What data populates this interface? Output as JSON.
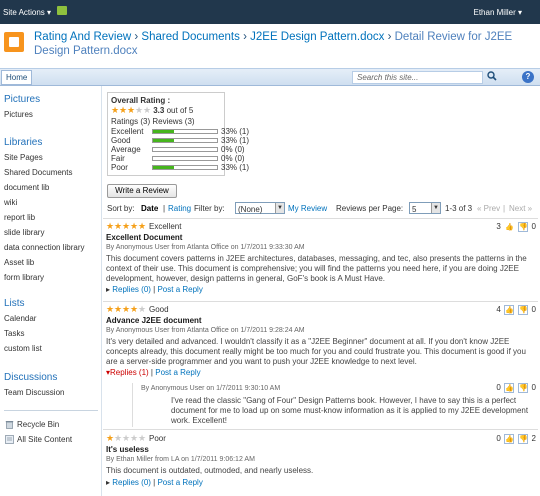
{
  "topbar": {
    "site_actions": "Site Actions",
    "site_actions_arrow": "▾",
    "user": "Ethan Miller",
    "user_arrow": "▾"
  },
  "breadcrumb": {
    "part1": "Rating And Review",
    "part2": "Shared Documents",
    "part3": "J2EE Design Pattern.docx",
    "current": "Detail Review for J2EE Design Pattern.docx",
    "sep": "›"
  },
  "nav": {
    "home": "Home",
    "search_placeholder": "Search this site...",
    "search_icon": "magnifier-icon",
    "help_label": "?"
  },
  "leftnav": {
    "pictures_header": "Pictures",
    "pictures_items": [
      "Pictures"
    ],
    "libraries_header": "Libraries",
    "libraries_items": [
      "Site Pages",
      "Shared Documents",
      "document lib",
      "wiki",
      "report lib",
      "slide library",
      "data connection library",
      "Asset lib",
      "form library"
    ],
    "lists_header": "Lists",
    "lists_items": [
      "Calendar",
      "Tasks",
      "custom list"
    ],
    "discussions_header": "Discussions",
    "discussions_items": [
      "Team Discussion"
    ],
    "recycle_bin": "Recycle Bin",
    "all_site_content": "All Site Content"
  },
  "overall": {
    "title": "Overall Rating :",
    "score": "3.3",
    "out_of": "out of 5",
    "stars": 3.3,
    "counts": "Ratings (3) Reviews (3)",
    "breakdown": [
      {
        "label": "Excellent",
        "fraction": 0.33,
        "text": "33% (1)"
      },
      {
        "label": "Good",
        "fraction": 0.33,
        "text": "33% (1)"
      },
      {
        "label": "Average",
        "fraction": 0.0,
        "text": "0% (0)"
      },
      {
        "label": "Fair",
        "fraction": 0.0,
        "text": "0% (0)"
      },
      {
        "label": "Poor",
        "fraction": 0.33,
        "text": "33% (1)"
      }
    ]
  },
  "write_review": "Write a Review",
  "sortbar": {
    "sort_by": "Sort by:",
    "date": "Date",
    "sep": "|",
    "rating": "Rating",
    "filter_by": "Filter by:",
    "filter_value": "(None)",
    "my_review": "My Review",
    "per_page": "Reviews per Page:",
    "per_page_value": "5",
    "range": "1-3 of 3",
    "prev": "« Prev",
    "next": "Next »"
  },
  "reviews": [
    {
      "stars": 5,
      "rating_label": "Excellent",
      "up": "3",
      "down": "0",
      "title": "Excellent Document",
      "byline": "By Anonymous User from Atlanta Office on 1/7/2011 9:33:30 AM",
      "body": "This document covers patterns in J2EE architectures, databases, messaging, and tec, also presents the patterns in the context of their use. This document is comprehensive; you will find the patterns you need here, if you are doing J2EE development, however, design patterns in general, GoF's book is A Must Have.",
      "replies": "Replies (0)",
      "post": "Post a Reply"
    },
    {
      "stars": 4,
      "rating_label": "Good",
      "up": "4",
      "down": "0",
      "title": "Advance J2EE document",
      "byline": "By Anonymous User from Atlanta Office on 1/7/2011 9:28:24 AM",
      "body": "It's very detailed and advanced. I wouldn't classify it as a \"J2EE Beginner\" document at all. If you don't know J2EE concepts already, this document really might be too much for you and could frustrate you. This document is good if you are a server-side programmer and you want to push your J2EE knowledge to next level.",
      "replies": "Replies (1)",
      "post": "Post a Reply",
      "reply": {
        "byline": "By Anonymous User on 1/7/2011 9:30:10 AM",
        "up": "0",
        "down": "0",
        "body": "I've read the classic \"Gang of Four\" Design Patterns book. However, I have to say this is a perfect document for me to load up on some must-know information as it is applied to my J2EE development work. Excellent!"
      }
    },
    {
      "stars": 1,
      "rating_label": "Poor",
      "up": "0",
      "down": "2",
      "title": "It's useless",
      "byline": "By Ethan Miller from LA on 1/7/2011 9:06:12 AM",
      "body": "This document is outdated, outmoded, and nearly useless.",
      "replies": "Replies (0)",
      "post": "Post a Reply"
    }
  ],
  "colors": {
    "topbar": "#21374c",
    "link": "#0072bc",
    "bar_fill": "#46b51d",
    "star": "#f5a01a"
  }
}
